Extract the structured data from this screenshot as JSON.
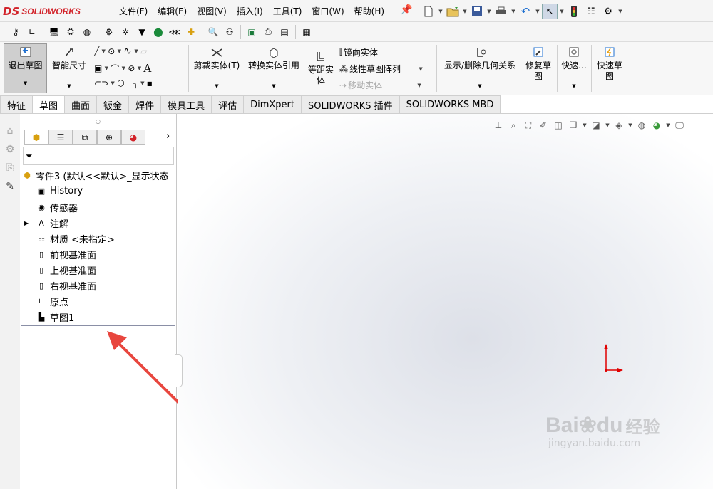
{
  "app": {
    "logo_ds": "DS",
    "logo_text": "SOLIDWORKS"
  },
  "menu": [
    "文件(F)",
    "编辑(E)",
    "视图(V)",
    "插入(I)",
    "工具(T)",
    "窗口(W)",
    "帮助(H)"
  ],
  "command": {
    "exit_sketch": "退出草图",
    "smart_dim": "智能尺寸",
    "trim": "剪裁实体(T)",
    "convert": "转换实体引用",
    "offset_l1": "等距实",
    "offset_l2": "体",
    "mirror": "镜向实体",
    "linear_pattern": "线性草图阵列",
    "move": "移动实体",
    "show_delete": "显示/删除几何关系",
    "repair_l1": "修复草",
    "repair_l2": "图",
    "quick_snap": "快速...",
    "rapid_l1": "快速草",
    "rapid_l2": "图"
  },
  "tabs": [
    "特征",
    "草图",
    "曲面",
    "钣金",
    "焊件",
    "模具工具",
    "评估",
    "DimXpert",
    "SOLIDWORKS 插件",
    "SOLIDWORKS MBD"
  ],
  "active_tab": "草图",
  "tree": {
    "root": "零件3 (默认<<默认>_显示状态",
    "items": [
      "History",
      "传感器",
      "注解",
      "材质 <未指定>",
      "前视基准面",
      "上视基准面",
      "右视基准面",
      "原点",
      "草图1"
    ]
  },
  "watermark": {
    "brand": "Bai",
    "brand2": "du",
    "suffix": "经验",
    "url": "jingyan.baidu.com"
  },
  "colors": {
    "accent": "#d2232a",
    "arrow": "#e8463e",
    "origin": "#e00000"
  }
}
